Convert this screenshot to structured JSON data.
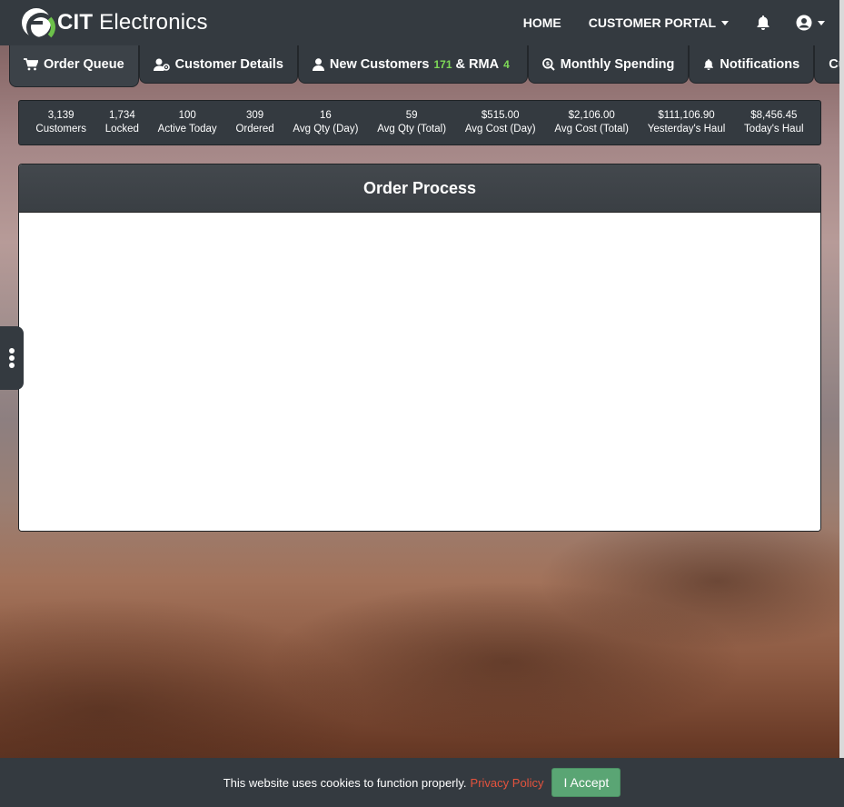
{
  "brand": {
    "bold": "CIT",
    "rest": " Electronics"
  },
  "nav": {
    "home": "HOME",
    "portal": "CUSTOMER PORTAL"
  },
  "tabs": [
    {
      "label": "Order Queue",
      "icon": "cart-icon"
    },
    {
      "label": "Customer Details",
      "icon": "user-gear-icon"
    },
    {
      "label": "New Customers",
      "count1": "171",
      "mid": "& RMA",
      "count2": "4",
      "icon": "user-icon"
    },
    {
      "label": "Monthly Spending",
      "icon": "magnify-dollar-icon"
    },
    {
      "label": "Notifications",
      "icon": "bell-icon"
    },
    {
      "label": "Customers",
      "icon": ""
    }
  ],
  "stats": [
    {
      "value": "3,139",
      "label": "Customers"
    },
    {
      "value": "1,734",
      "label": "Locked"
    },
    {
      "value": "100",
      "label": "Active Today"
    },
    {
      "value": "309",
      "label": "Ordered"
    },
    {
      "value": "16",
      "label": "Avg Qty (Day)"
    },
    {
      "value": "59",
      "label": "Avg Qty (Total)"
    },
    {
      "value": "$515.00",
      "label": "Avg Cost (Day)"
    },
    {
      "value": "$2,106.00",
      "label": "Avg Cost (Total)"
    },
    {
      "value": "$111,106.90",
      "label": "Yesterday's Haul"
    },
    {
      "value": "$8,456.45",
      "label": "Today's Haul"
    }
  ],
  "panel": {
    "title": "Order Process"
  },
  "cookie": {
    "text": "This website uses cookies to function properly.",
    "link": "Privacy Policy",
    "button": "I Accept"
  },
  "colors": {
    "accent_green": "#7ed957",
    "nav_bg": "#343a40",
    "link_red": "#e5533d",
    "accept_green": "#5aa574"
  }
}
